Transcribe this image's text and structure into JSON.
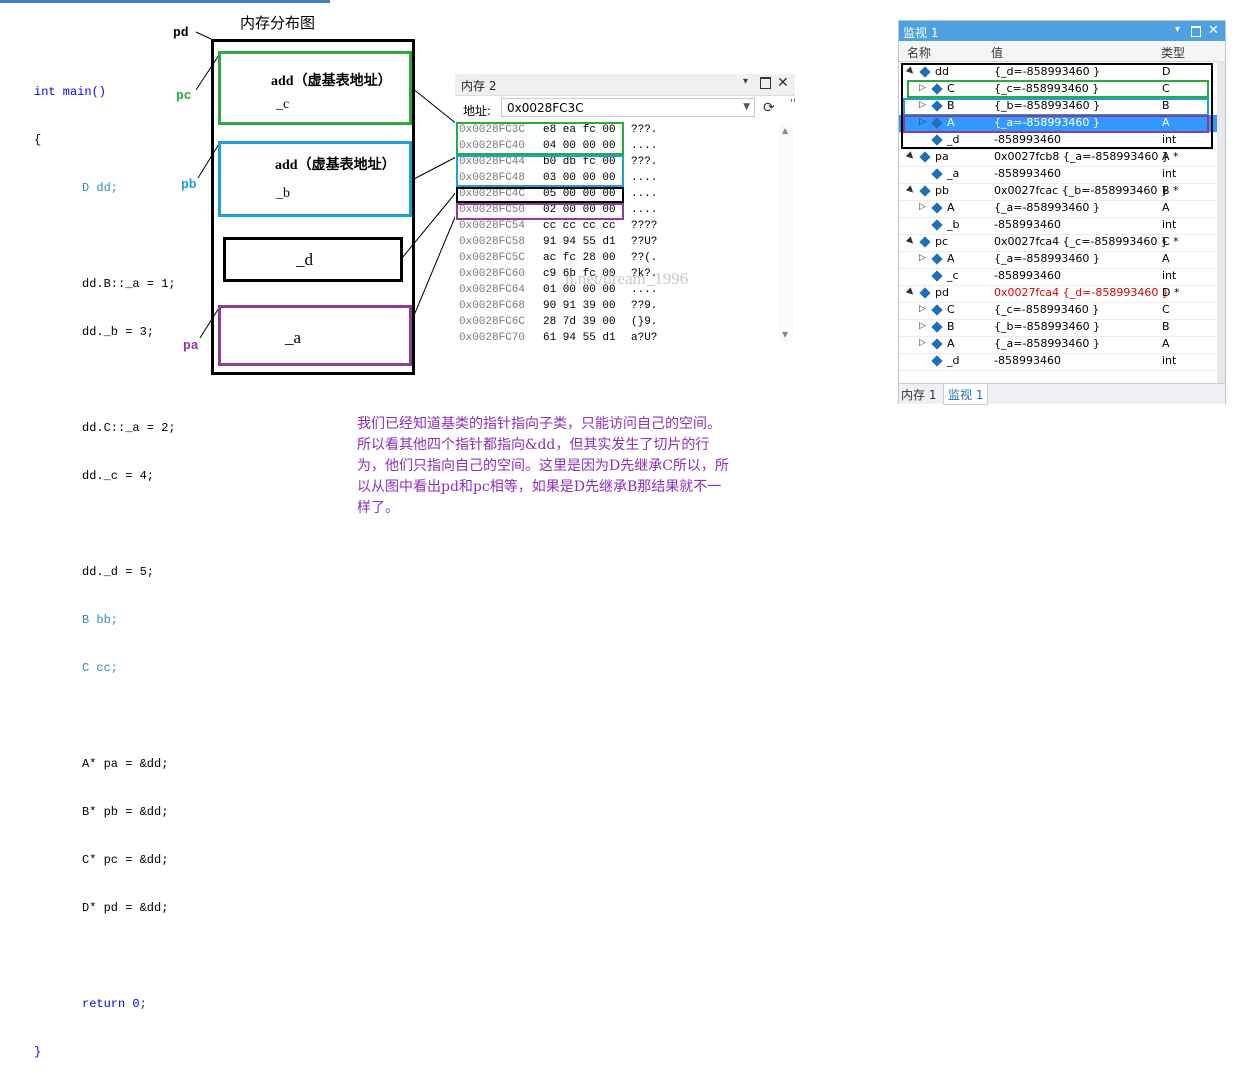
{
  "code_lines": [
    "int main()",
    "{",
    "D dd;",
    "dd.B::_a = 1;",
    "dd._b = 3;",
    "dd.C::_a = 2;",
    "dd._c = 4;",
    "dd._d = 5;",
    "B bb;",
    "C cc;",
    "A* pa = &dd;",
    "B* pb = &dd;",
    "C* pc = &dd;",
    "D* pd = &dd;",
    "return 0;",
    "}"
  ],
  "diagram": {
    "title": "内存分布图",
    "pd_label": "pd",
    "pc_label": "pc",
    "pb_label": "pb",
    "pa_label": "pa",
    "c_box_line1": "add（虚基表地址）",
    "c_box_line2": "_c",
    "b_box_line1": "add（虚基表地址）",
    "b_box_line2": "_b",
    "d_box": "_d",
    "a_box": "_a",
    "colors": {
      "green": "#2eaa3c",
      "blue": "#1e9fd8",
      "purple": "#8e3c98",
      "black": "#000000"
    }
  },
  "memory_window": {
    "title": "内存 2",
    "address_label": "地址:",
    "address_value": "0x0028FC3C",
    "rows": [
      {
        "addr": "0x0028FC3C",
        "bytes": "e8 ea fc 00",
        "chars": "???."
      },
      {
        "addr": "0x0028FC40",
        "bytes": "04 00 00 00",
        "chars": "...."
      },
      {
        "addr": "0x0028FC44",
        "bytes": "b0 db fc 00",
        "chars": "???."
      },
      {
        "addr": "0x0028FC48",
        "bytes": "03 00 00 00",
        "chars": "...."
      },
      {
        "addr": "0x0028FC4C",
        "bytes": "05 00 00 00",
        "chars": "...."
      },
      {
        "addr": "0x0028FC50",
        "bytes": "02 00 00 00",
        "chars": "...."
      },
      {
        "addr": "0x0028FC54",
        "bytes": "cc cc cc cc",
        "chars": "????"
      },
      {
        "addr": "0x0028FC58",
        "bytes": "91 94 55 d1",
        "chars": "??U?"
      },
      {
        "addr": "0x0028FC5C",
        "bytes": "ac fc 28 00",
        "chars": "??(."
      },
      {
        "addr": "0x0028FC60",
        "bytes": "c9 6b fc 00",
        "chars": "?k?."
      },
      {
        "addr": "0x0028FC64",
        "bytes": "01 00 00 00",
        "chars": "...."
      },
      {
        "addr": "0x0028FC68",
        "bytes": "90 91 39 00",
        "chars": "??9."
      },
      {
        "addr": "0x0028FC6C",
        "bytes": "28 7d 39 00",
        "chars": "(}9."
      },
      {
        "addr": "0x0028FC70",
        "bytes": "61 94 55 d1",
        "chars": "a?U?"
      }
    ]
  },
  "watermark": "n.net/dream_1996",
  "note": "我们已经知道基类的指针指向子类，只能访问自己的空间。所以看其他四个指针都指向&dd，但其实发生了切片的行为，他们只指向自己的空间。这里是因为D先继承C所以，所以从图中看出pd和pc相等，如果是D先继承B那结果就不一样了。",
  "watch_window": {
    "title": "监视 1",
    "col_name": "名称",
    "col_value": "值",
    "col_type": "类型",
    "rows": [
      {
        "indent": 0,
        "tri": "▲",
        "name": "dd",
        "value": "{_d=-858993460 }",
        "type": "D"
      },
      {
        "indent": 1,
        "tri": "▷",
        "name": "C",
        "value": "{_c=-858993460 }",
        "type": "C"
      },
      {
        "indent": 1,
        "tri": "▷",
        "name": "B",
        "value": "{_b=-858993460 }",
        "type": "B"
      },
      {
        "indent": 1,
        "tri": "▷",
        "name": "A",
        "value": "{_a=-858993460 }",
        "type": "A"
      },
      {
        "indent": 1,
        "tri": "",
        "name": "_d",
        "value": "-858993460",
        "type": "int"
      },
      {
        "indent": 0,
        "tri": "▲",
        "name": "pa",
        "value": "0x0027fcb8 {_a=-858993460 }",
        "type": "A *"
      },
      {
        "indent": 1,
        "tri": "",
        "name": "_a",
        "value": "-858993460",
        "type": "int"
      },
      {
        "indent": 0,
        "tri": "▲",
        "name": "pb",
        "value": "0x0027fcac {_b=-858993460 }",
        "type": "B *"
      },
      {
        "indent": 1,
        "tri": "▷",
        "name": "A",
        "value": "{_a=-858993460 }",
        "type": "A"
      },
      {
        "indent": 1,
        "tri": "",
        "name": "_b",
        "value": "-858993460",
        "type": "int"
      },
      {
        "indent": 0,
        "tri": "▲",
        "name": "pc",
        "value": "0x0027fca4 {_c=-858993460 }",
        "type": "C *"
      },
      {
        "indent": 1,
        "tri": "▷",
        "name": "A",
        "value": "{_a=-858993460 }",
        "type": "A"
      },
      {
        "indent": 1,
        "tri": "",
        "name": "_c",
        "value": "-858993460",
        "type": "int"
      },
      {
        "indent": 0,
        "tri": "▲",
        "name": "pd",
        "value": "0x0027fca4 {_d=-858993460 }",
        "type": "D *"
      },
      {
        "indent": 1,
        "tri": "▷",
        "name": "C",
        "value": "{_c=-858993460 }",
        "type": "C"
      },
      {
        "indent": 1,
        "tri": "▷",
        "name": "B",
        "value": "{_b=-858993460 }",
        "type": "B"
      },
      {
        "indent": 1,
        "tri": "▷",
        "name": "A",
        "value": "{_a=-858993460 }",
        "type": "A"
      },
      {
        "indent": 1,
        "tri": "",
        "name": "_d",
        "value": "-858993460",
        "type": "int"
      }
    ],
    "tab_memory": "内存 1",
    "tab_watch": "监视 1"
  }
}
